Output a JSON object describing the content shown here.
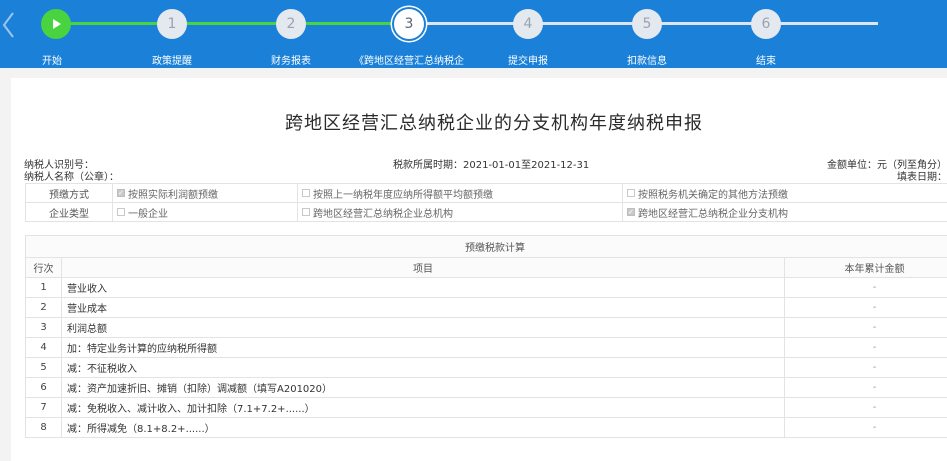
{
  "stepper": {
    "steps": [
      {
        "number": "",
        "label": "开始",
        "state": "start"
      },
      {
        "number": "1",
        "label": "政策提醒",
        "state": "todo"
      },
      {
        "number": "2",
        "label": "财务报表",
        "state": "todo"
      },
      {
        "number": "3",
        "label": "《跨地区经营汇总纳税企",
        "state": "current"
      },
      {
        "number": "4",
        "label": "提交申报",
        "state": "todo"
      },
      {
        "number": "5",
        "label": "扣款信息",
        "state": "todo"
      },
      {
        "number": "6",
        "label": "结束",
        "state": "todo"
      }
    ],
    "colors": {
      "bar": "#1a80d8",
      "done": "#49d33f",
      "todo": "#dfe5ee"
    }
  },
  "form": {
    "title": "跨地区经营汇总纳税企业的分支机构年度纳税申报",
    "taxpayer_id_label": "纳税人识别号：",
    "taxpayer_name_label": "纳税人名称（公章）：",
    "period": "税款所属时期：2021-01-01至2021-12-31",
    "unit": "金额单位：元（列至角分）",
    "fill_date": "填表日期："
  },
  "options": {
    "prepay_label": "预缴方式",
    "prepay_items": [
      {
        "text": "按照实际利润额预缴",
        "checked": true
      },
      {
        "text": "按照上一纳税年度应纳所得额平均额预缴",
        "checked": false
      },
      {
        "text": "按照税务机关确定的其他方法预缴",
        "checked": false
      }
    ],
    "type_label": "企业类型",
    "type_items": [
      {
        "text": "一般企业",
        "checked": false
      },
      {
        "text": "跨地区经营汇总纳税企业总机构",
        "checked": false
      },
      {
        "text": "跨地区经营汇总纳税企业分支机构",
        "checked": true
      }
    ]
  },
  "calc": {
    "section_title": "预缴税款计算",
    "col_row": "行次",
    "col_item": "项目",
    "col_amount": "本年累计金额",
    "rows": [
      {
        "no": "1",
        "item": "营业收入",
        "amount": "-"
      },
      {
        "no": "2",
        "item": "营业成本",
        "amount": "-"
      },
      {
        "no": "3",
        "item": "利润总额",
        "amount": "-"
      },
      {
        "no": "4",
        "item": "加：特定业务计算的应纳税所得额",
        "amount": "-"
      },
      {
        "no": "5",
        "item": "减：不征税收入",
        "amount": "-"
      },
      {
        "no": "6",
        "item": "减：资产加速折旧、摊销（扣除）调减额（填写A201020）",
        "amount": "-"
      },
      {
        "no": "7",
        "item": "减：免税收入、减计收入、加计扣除（7.1+7.2+......）",
        "amount": "-"
      },
      {
        "no": "8",
        "item": "减：所得减免（8.1+8.2+......）",
        "amount": "-"
      }
    ]
  }
}
